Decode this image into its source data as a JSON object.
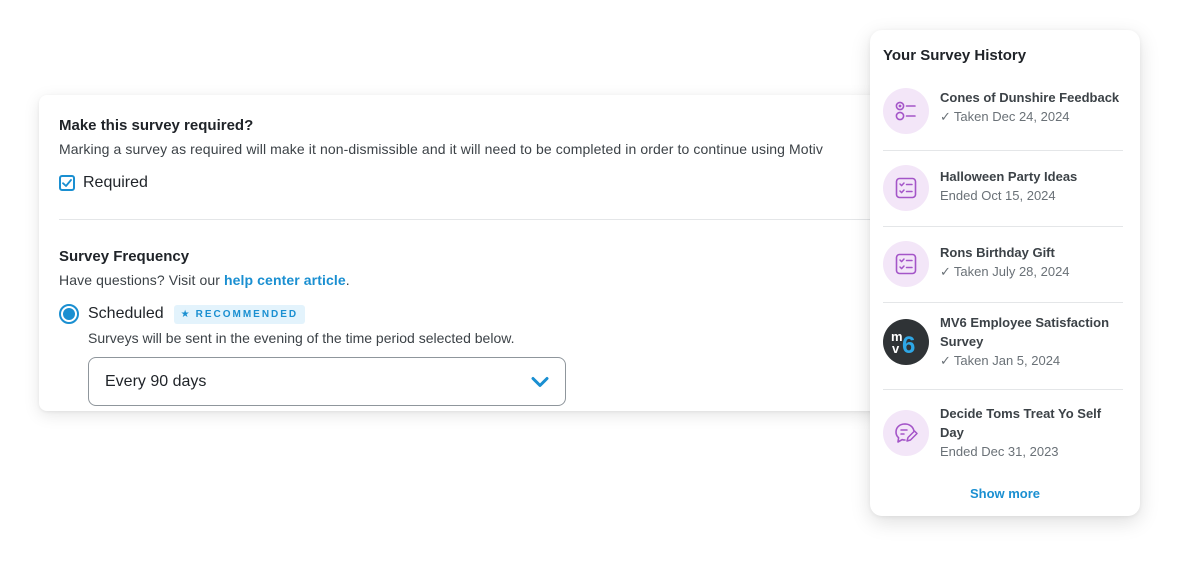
{
  "required_section": {
    "title": "Make this survey required?",
    "description": "Marking a survey as required will make it non-dismissible and it will need to be completed in order to continue using Motiv",
    "checkbox_label": "Required",
    "checked": true
  },
  "frequency_section": {
    "title": "Survey Frequency",
    "help_prefix": "Have questions? Visit our ",
    "help_link": "help center article",
    "help_suffix": ".",
    "option_label": "Scheduled",
    "badge": "RECOMMENDED",
    "option_help": "Surveys will be sent in the evening of the time period selected below.",
    "select_value": "Every 90 days"
  },
  "history": {
    "title": "Your Survey History",
    "show_more": "Show more",
    "items": [
      {
        "title": "Cones of Dunshire Feedback",
        "status": "Taken Dec 24, 2024",
        "taken": true,
        "icon": "options-list-icon"
      },
      {
        "title": "Halloween Party Ideas",
        "status": "Ended Oct 15, 2024",
        "taken": false,
        "icon": "checklist-icon"
      },
      {
        "title": "Rons Birthday Gift",
        "status": "Taken July 28, 2024",
        "taken": true,
        "icon": "checklist-icon"
      },
      {
        "title": "MV6 Employee Satisfaction Survey",
        "status": "Taken Jan 5, 2024",
        "taken": true,
        "icon": "mv6-logo"
      },
      {
        "title": "Decide Toms Treat Yo Self Day",
        "status": "Ended Dec 31, 2023",
        "taken": false,
        "icon": "speech-pen-icon"
      }
    ]
  },
  "colors": {
    "accent": "#1a8fd1",
    "icon_bg": "#f3e6f8",
    "icon_stroke": "#a455c8"
  }
}
